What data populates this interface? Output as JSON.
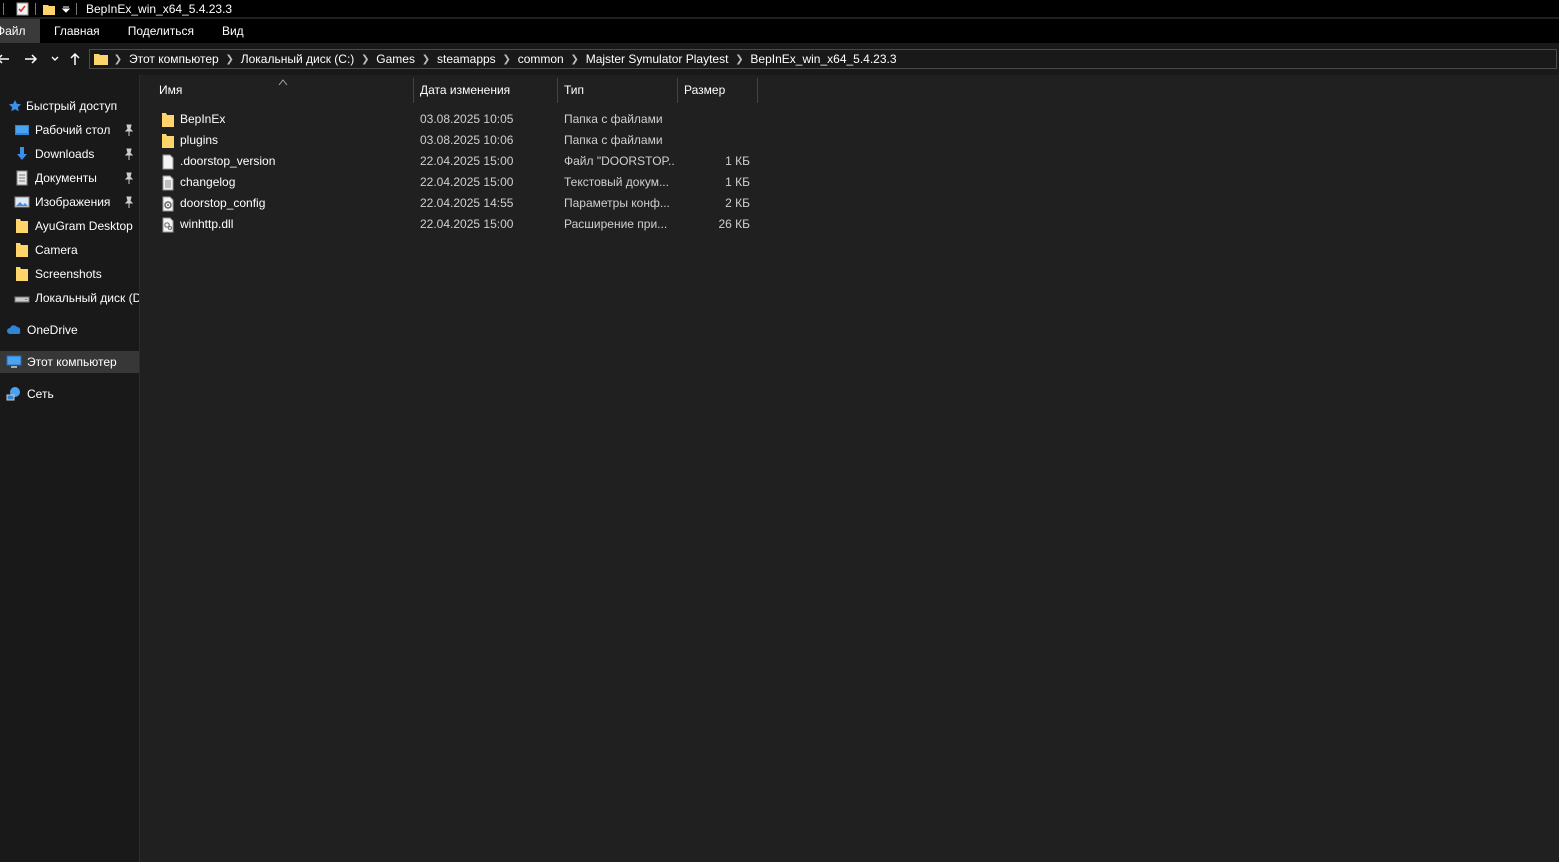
{
  "window": {
    "title": "BepInEx_win_x64_5.4.23.3"
  },
  "ribbon": {
    "tabs": [
      "Файл",
      "Главная",
      "Поделиться",
      "Вид"
    ]
  },
  "address": {
    "crumbs": [
      "Этот компьютер",
      "Локальный диск (C:)",
      "Games",
      "steamapps",
      "common",
      "Majster Symulator Playtest",
      "BepInEx_win_x64_5.4.23.3"
    ]
  },
  "sidebar": {
    "items": [
      {
        "label": "Быстрый доступ",
        "icon": "star-icon",
        "pinned": false
      },
      {
        "label": "Рабочий стол",
        "icon": "desktop-icon",
        "pinned": true
      },
      {
        "label": "Downloads",
        "icon": "download-arrow-icon",
        "pinned": true
      },
      {
        "label": "Документы",
        "icon": "document-icon",
        "pinned": true
      },
      {
        "label": "Изображения",
        "icon": "pictures-icon",
        "pinned": true
      },
      {
        "label": "AyuGram Desktop",
        "icon": "folder-icon",
        "pinned": false
      },
      {
        "label": "Camera",
        "icon": "folder-icon",
        "pinned": false
      },
      {
        "label": "Screenshots",
        "icon": "folder-icon",
        "pinned": false
      },
      {
        "label": "Локальный диск (D",
        "icon": "drive-icon",
        "pinned": false
      },
      {
        "label": "OneDrive",
        "icon": "cloud-icon",
        "pinned": false
      },
      {
        "label": "Этот компьютер",
        "icon": "computer-icon",
        "pinned": false,
        "selected": true
      },
      {
        "label": "Сеть",
        "icon": "network-icon",
        "pinned": false
      }
    ]
  },
  "filelist": {
    "columns": {
      "name": "Имя",
      "date": "Дата изменения",
      "type": "Тип",
      "size": "Размер"
    },
    "rows": [
      {
        "name": "BepInEx",
        "date": "03.08.2025 10:05",
        "type": "Папка с файлами",
        "size": "",
        "icon": "folder-icon"
      },
      {
        "name": "plugins",
        "date": "03.08.2025 10:06",
        "type": "Папка с файлами",
        "size": "",
        "icon": "folder-icon"
      },
      {
        "name": ".doorstop_version",
        "date": "22.04.2025 15:00",
        "type": "Файл \"DOORSTOP...",
        "size": "1 КБ",
        "icon": "blank-file-icon"
      },
      {
        "name": "changelog",
        "date": "22.04.2025 15:00",
        "type": "Текстовый докум...",
        "size": "1 КБ",
        "icon": "text-file-icon"
      },
      {
        "name": "doorstop_config",
        "date": "22.04.2025 14:55",
        "type": "Параметры конф...",
        "size": "2 КБ",
        "icon": "config-file-icon"
      },
      {
        "name": "winhttp.dll",
        "date": "22.04.2025 15:00",
        "type": "Расширение при...",
        "size": "26 КБ",
        "icon": "dll-file-icon"
      }
    ]
  },
  "colors": {
    "folder": "#ffd56b",
    "background": "#202020",
    "sidebar": "#191919",
    "chrome": "#000000"
  }
}
